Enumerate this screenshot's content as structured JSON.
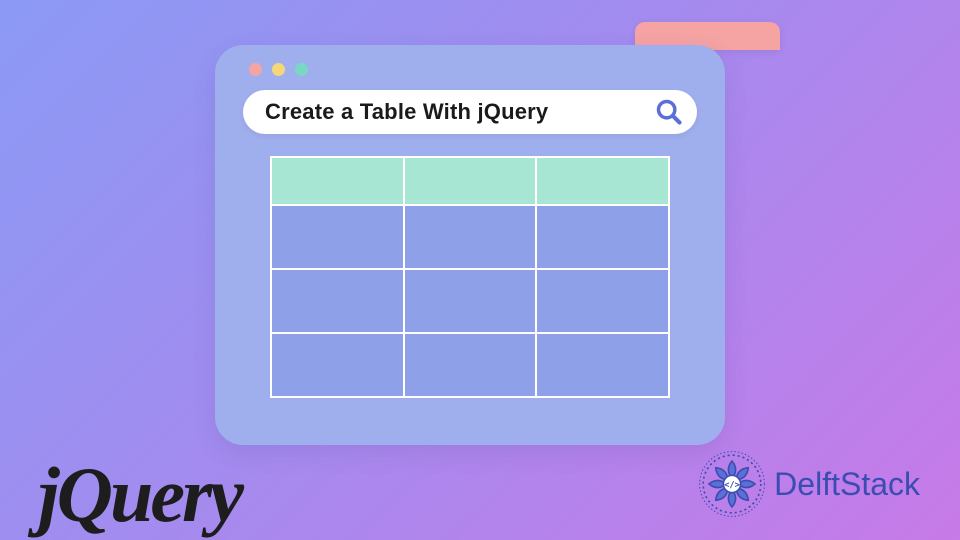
{
  "accent": {
    "color": "#f5a3a3"
  },
  "window": {
    "traffic_lights": [
      "red",
      "yellow",
      "green"
    ],
    "search_text": "Create a Table With jQuery"
  },
  "table": {
    "rows": 4,
    "cols": 3,
    "header_bg": "#a8e6d4",
    "cell_bg": "#8ea1e8"
  },
  "logos": {
    "jquery": "jQuery",
    "delftstack": "DelftStack"
  },
  "icons": {
    "search": "search-icon",
    "mandala": "mandala-icon",
    "code": "code-icon"
  }
}
